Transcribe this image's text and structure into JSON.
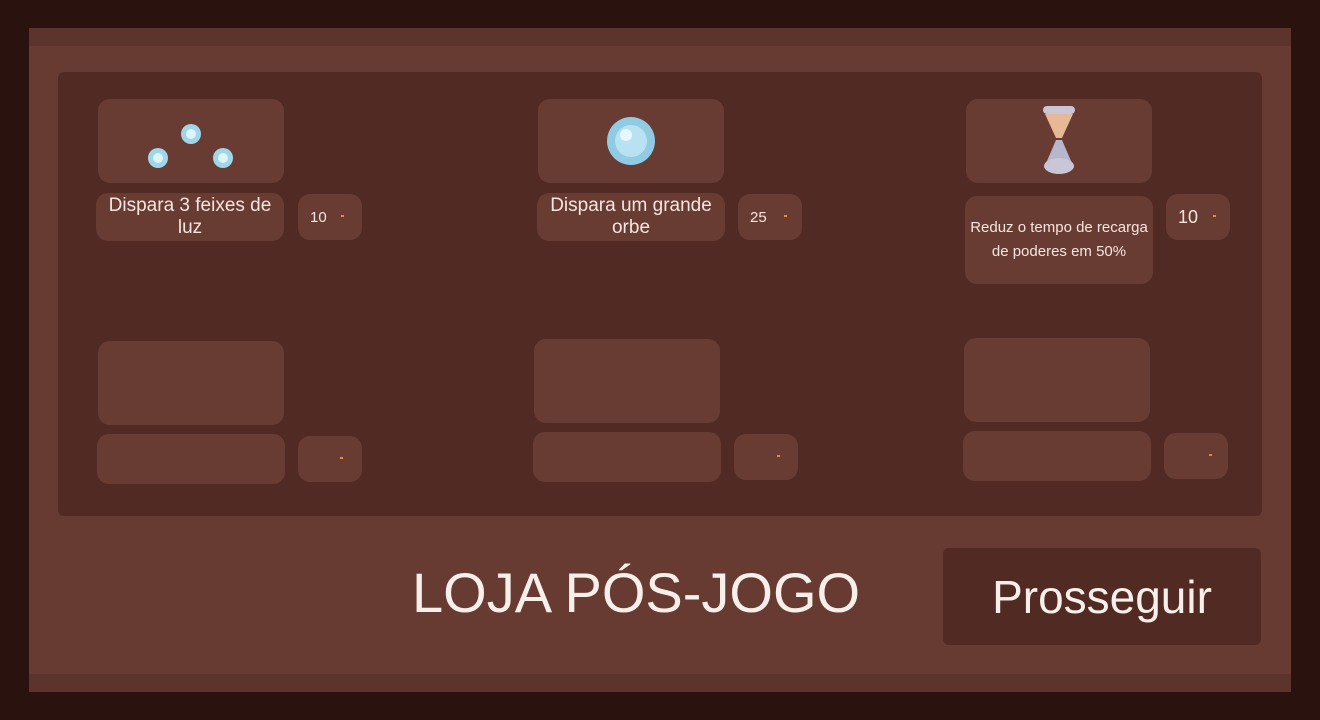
{
  "shop": {
    "title": "LOJA PÓS-JOGO",
    "continue_label": "Prosseguir",
    "items": [
      {
        "icon": "three-orbs-icon",
        "description": "Dispara 3 feixes de luz",
        "price": "10"
      },
      {
        "icon": "big-orb-icon",
        "description": "Dispara um grande orbe",
        "price": "25"
      },
      {
        "icon": "hourglass-icon",
        "description": "Reduz o tempo de recarga de poderes em 50%",
        "price": "10"
      },
      {
        "icon": "",
        "description": "",
        "price": ""
      },
      {
        "icon": "",
        "description": "",
        "price": ""
      },
      {
        "icon": "",
        "description": "",
        "price": ""
      }
    ]
  },
  "colors": {
    "background": "#2a130f",
    "frame": "#673b32",
    "panel": "#512a24",
    "card": "#693c33",
    "text": "#f3e6df",
    "coin": "#e08a3c",
    "orb": "#9fd6ea"
  }
}
